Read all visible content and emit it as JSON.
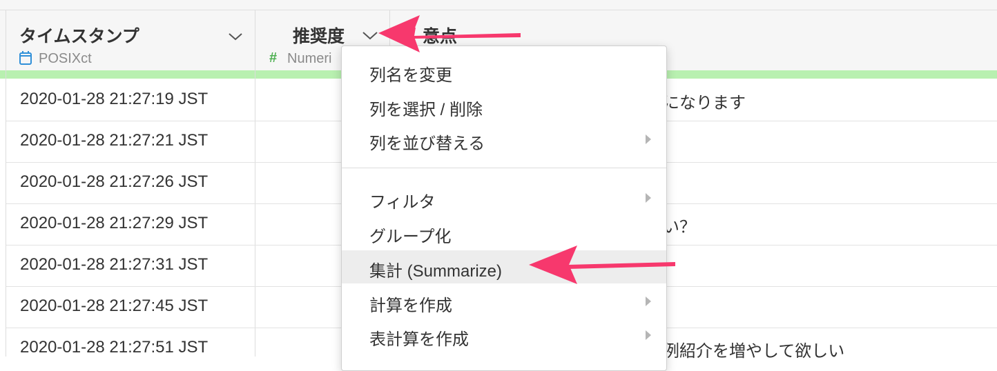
{
  "columns": [
    {
      "title": "タイムスタンプ",
      "type": "POSIXct",
      "type_icon": "calendar-icon"
    },
    {
      "title": "推奨度",
      "type": "Numeri",
      "type_icon": "hash-icon"
    },
    {
      "title": "意点"
    }
  ],
  "rows": [
    {
      "timestamp": "2020-01-28 21:27:19 JST",
      "right_text": "になります"
    },
    {
      "timestamp": "2020-01-28 21:27:21 JST",
      "right_text": ""
    },
    {
      "timestamp": "2020-01-28 21:27:26 JST",
      "right_text": ""
    },
    {
      "timestamp": "2020-01-28 21:27:29 JST",
      "right_text": "い？"
    },
    {
      "timestamp": "2020-01-28 21:27:31 JST",
      "right_text": ""
    },
    {
      "timestamp": "2020-01-28 21:27:45 JST",
      "right_text": ""
    },
    {
      "timestamp": "2020-01-28 21:27:51 JST",
      "right_text": "例紹介を増やして欲しい"
    }
  ],
  "menu": {
    "items": [
      {
        "label": "列名を変更",
        "submenu": false
      },
      {
        "label": "列を選択 / 削除",
        "submenu": false
      },
      {
        "label": "列を並び替える",
        "submenu": true
      },
      {
        "label": "フィルタ",
        "submenu": true
      },
      {
        "label": "グループ化",
        "submenu": false
      },
      {
        "label": "集計 (Summarize)",
        "submenu": false,
        "highlighted": true
      },
      {
        "label": "計算を作成",
        "submenu": true
      },
      {
        "label": "表計算を作成",
        "submenu": true
      }
    ]
  },
  "colors": {
    "accent_arrow": "#f7386d",
    "green_bar": "#b8f0b0",
    "numeric_icon": "#4caf50",
    "date_icon": "#2f8fd8"
  }
}
